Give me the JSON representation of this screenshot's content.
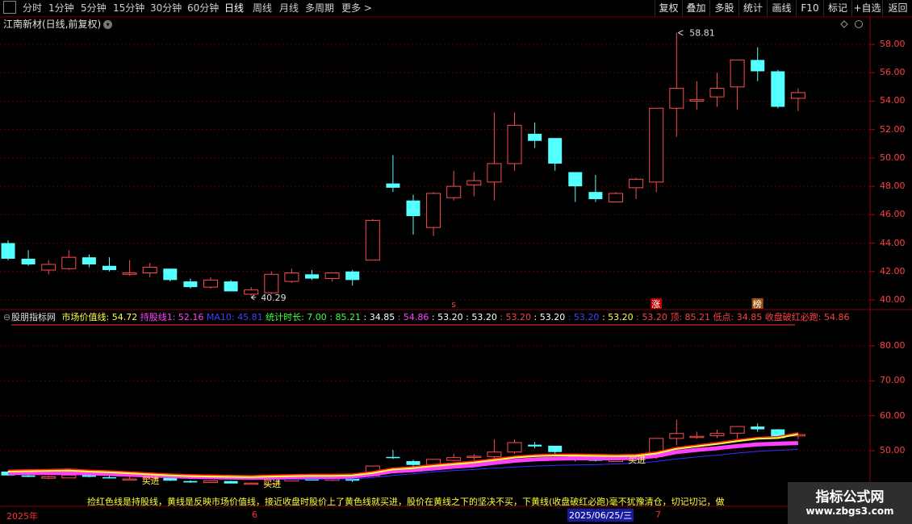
{
  "toolbar": {
    "left_tabs": [
      "分时",
      "1分钟",
      "5分钟",
      "15分钟",
      "30分钟",
      "60分钟",
      "日线",
      "周线",
      "月线",
      "多周期",
      "更多 >"
    ],
    "active_tab": "日线",
    "right_buttons": [
      "复权",
      "叠加",
      "多股",
      "统计",
      "画线",
      "F10",
      "标记",
      "+自选",
      "返回"
    ]
  },
  "chart_title": "江南新材(日线,前复权)",
  "price_axis": [
    "58.00",
    "56.00",
    "54.00",
    "52.00",
    "50.00",
    "48.00",
    "46.00",
    "44.00",
    "42.00",
    "40.00"
  ],
  "high_annotation": "58.81",
  "low_annotation": "40.29",
  "signal_marks": {
    "s": "s",
    "zhang": "涨",
    "bang": "榜"
  },
  "indicator": {
    "name": "股朋指标网",
    "items": [
      {
        "text": "市场价值线: 54.72",
        "color": "#ffff40"
      },
      {
        "text": "持股线1: 52.16",
        "color": "#ff40ff"
      },
      {
        "text": "MA10: 45.81",
        "color": "#4040ff"
      },
      {
        "text": "统计时长: 7.00",
        "color": "#40ff40"
      },
      {
        "text": ": 85.21",
        "color": "#40ff40"
      },
      {
        "text": ": 34.85",
        "color": "#ffffff"
      },
      {
        "text": ": 54.86",
        "color": "#ff40ff"
      },
      {
        "text": ": 53.20",
        "color": "#ffffff"
      },
      {
        "text": ": 53.20",
        "color": "#ffffff"
      },
      {
        "text": ": 53.20",
        "color": "#ff4040"
      },
      {
        "text": ": 53.20",
        "color": "#ffffff"
      },
      {
        "text": ": 53.20",
        "color": "#4040ff"
      },
      {
        "text": ": 53.20",
        "color": "#ffff40"
      },
      {
        "text": ": 53.20",
        "color": "#ff4040"
      },
      {
        "text": "顶: 85.21",
        "color": "#ff4040"
      },
      {
        "text": "低点: 34.85",
        "color": "#ff4040"
      },
      {
        "text": "收盘破红必跑: 54.86",
        "color": "#ff4040"
      }
    ]
  },
  "indicator_axis": [
    "80.00",
    "70.00",
    "60.00",
    "50.00"
  ],
  "buy_labels": [
    "买进",
    "买进",
    "买进"
  ],
  "warning_text": "捡红色线是持股线，黄线是反映市场价值线，接近收盘时股价上了黄色线就买进，股价在黄线之下的坚决不买，下黄线(收盘破红必跑)毫不犹豫清仓，切记切记，做",
  "dates": {
    "year": "2025年",
    "m6": "6",
    "cursor": "2025/06/25/三",
    "m7": "7"
  },
  "watermark": {
    "line1": "指标公式网",
    "line2": "www.zbgs3.com"
  },
  "chart_data": {
    "type": "candlestick",
    "price_range": [
      39.5,
      59.5
    ],
    "candles": [
      {
        "o": 44.0,
        "h": 44.2,
        "l": 42.8,
        "c": 42.9
      },
      {
        "o": 42.9,
        "h": 43.5,
        "l": 42.4,
        "c": 42.5
      },
      {
        "o": 42.1,
        "h": 42.8,
        "l": 41.8,
        "c": 42.5
      },
      {
        "o": 42.2,
        "h": 43.5,
        "l": 42.1,
        "c": 43.0
      },
      {
        "o": 43.0,
        "h": 43.2,
        "l": 42.3,
        "c": 42.5
      },
      {
        "o": 42.4,
        "h": 43.0,
        "l": 42.0,
        "c": 42.1
      },
      {
        "o": 41.8,
        "h": 42.8,
        "l": 41.7,
        "c": 41.9
      },
      {
        "o": 41.9,
        "h": 42.6,
        "l": 41.6,
        "c": 42.3
      },
      {
        "o": 42.2,
        "h": 42.2,
        "l": 41.3,
        "c": 41.4
      },
      {
        "o": 41.3,
        "h": 41.5,
        "l": 40.8,
        "c": 40.9
      },
      {
        "o": 40.9,
        "h": 41.6,
        "l": 40.8,
        "c": 41.4
      },
      {
        "o": 41.3,
        "h": 41.4,
        "l": 40.6,
        "c": 40.6
      },
      {
        "o": 40.4,
        "h": 40.9,
        "l": 40.29,
        "c": 40.7
      },
      {
        "o": 40.5,
        "h": 42.0,
        "l": 40.4,
        "c": 41.8
      },
      {
        "o": 41.3,
        "h": 42.2,
        "l": 41.2,
        "c": 41.9
      },
      {
        "o": 41.8,
        "h": 42.1,
        "l": 41.4,
        "c": 41.5
      },
      {
        "o": 41.5,
        "h": 41.9,
        "l": 41.3,
        "c": 41.9
      },
      {
        "o": 42.0,
        "h": 42.1,
        "l": 41.0,
        "c": 41.4
      },
      {
        "o": 42.8,
        "h": 45.7,
        "l": 42.8,
        "c": 45.6
      },
      {
        "o": 48.2,
        "h": 50.2,
        "l": 47.6,
        "c": 47.9
      },
      {
        "o": 47.0,
        "h": 47.4,
        "l": 44.6,
        "c": 45.9
      },
      {
        "o": 45.1,
        "h": 47.6,
        "l": 44.5,
        "c": 47.5
      },
      {
        "o": 47.2,
        "h": 49.1,
        "l": 47.0,
        "c": 48.0
      },
      {
        "o": 48.1,
        "h": 49.0,
        "l": 47.3,
        "c": 48.4
      },
      {
        "o": 48.3,
        "h": 53.2,
        "l": 47.0,
        "c": 49.6
      },
      {
        "o": 49.6,
        "h": 53.2,
        "l": 49.1,
        "c": 52.3
      },
      {
        "o": 51.7,
        "h": 52.5,
        "l": 50.7,
        "c": 51.2
      },
      {
        "o": 51.4,
        "h": 51.4,
        "l": 49.1,
        "c": 49.6
      },
      {
        "o": 49.0,
        "h": 49.0,
        "l": 46.9,
        "c": 48.0
      },
      {
        "o": 47.6,
        "h": 48.8,
        "l": 46.9,
        "c": 47.1
      },
      {
        "o": 46.9,
        "h": 47.6,
        "l": 46.9,
        "c": 47.5
      },
      {
        "o": 47.9,
        "h": 48.6,
        "l": 47.1,
        "c": 48.5
      },
      {
        "o": 48.3,
        "h": 53.5,
        "l": 47.6,
        "c": 53.5
      },
      {
        "o": 53.5,
        "h": 58.81,
        "l": 51.5,
        "c": 54.9
      },
      {
        "o": 54.0,
        "h": 55.4,
        "l": 53.4,
        "c": 54.1
      },
      {
        "o": 54.3,
        "h": 56.0,
        "l": 53.6,
        "c": 54.9
      },
      {
        "o": 55.0,
        "h": 56.9,
        "l": 53.4,
        "c": 56.9
      },
      {
        "o": 56.9,
        "h": 57.8,
        "l": 55.4,
        "c": 56.1
      },
      {
        "o": 56.1,
        "h": 56.2,
        "l": 53.5,
        "c": 53.6
      },
      {
        "o": 54.2,
        "h": 54.9,
        "l": 53.3,
        "c": 54.6
      }
    ],
    "indicator_range": [
      42,
      88
    ],
    "value_line": [
      44,
      44.1,
      44.2,
      44.3,
      44.0,
      43.8,
      43.5,
      43.2,
      42.9,
      42.7,
      42.6,
      42.5,
      42.4,
      42.6,
      42.7,
      42.8,
      42.8,
      42.9,
      43.6,
      44.6,
      45.0,
      45.6,
      46.1,
      46.6,
      47.3,
      48.0,
      48.4,
      48.6,
      48.6,
      48.5,
      48.4,
      48.5,
      49.2,
      50.5,
      51.2,
      51.9,
      52.7,
      53.4,
      53.6,
      54.72
    ],
    "hold_line": [
      43.6,
      43.6,
      43.6,
      43.6,
      43.5,
      43.3,
      43.1,
      42.9,
      42.7,
      42.5,
      42.4,
      42.3,
      42.2,
      42.3,
      42.4,
      42.5,
      42.5,
      42.6,
      43.2,
      44.1,
      44.4,
      44.9,
      45.4,
      45.8,
      46.5,
      47.1,
      47.5,
      47.7,
      47.8,
      47.8,
      47.8,
      47.9,
      48.5,
      49.6,
      50.2,
      50.7,
      51.3,
      51.8,
      52.0,
      52.16
    ],
    "ma10": [
      43.8,
      43.7,
      43.6,
      43.5,
      43.3,
      43.1,
      42.9,
      42.6,
      42.4,
      42.2,
      42.1,
      42.0,
      41.9,
      41.8,
      41.8,
      41.8,
      41.9,
      41.9,
      42.3,
      42.9,
      43.4,
      43.9,
      44.3,
      44.6,
      45.0,
      45.3,
      45.6,
      45.8,
      45.9,
      46.0,
      46.2,
      46.4,
      46.9,
      47.6,
      48.2,
      48.7,
      49.3,
      49.8,
      50.1,
      50.4
    ]
  }
}
